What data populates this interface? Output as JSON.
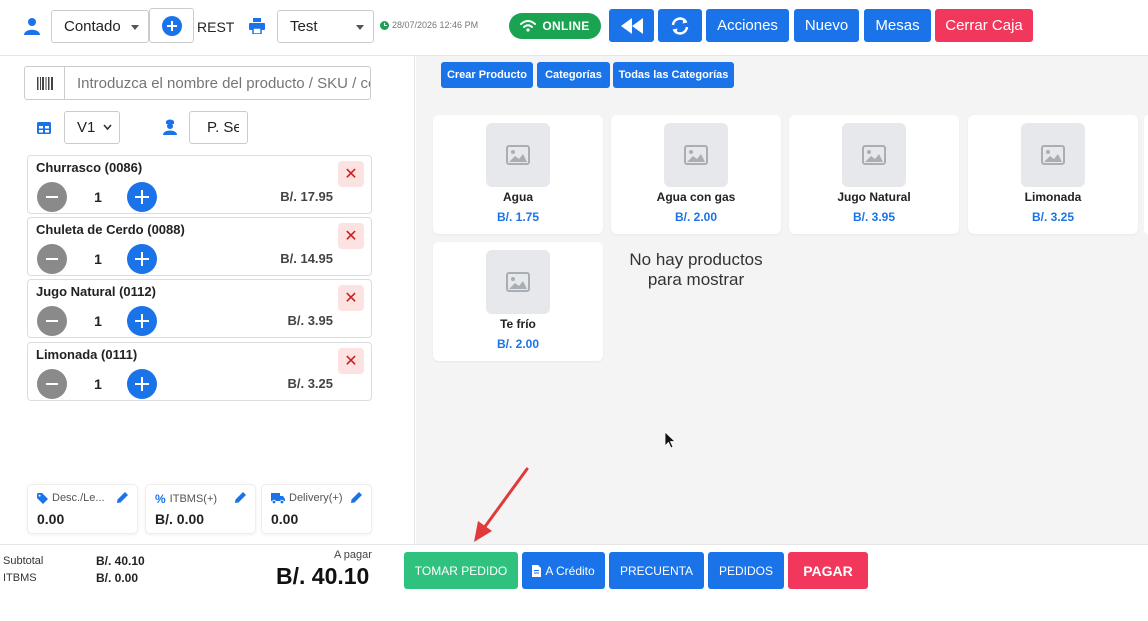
{
  "topbar": {
    "payment_type": "Contado",
    "mode_label": "REST",
    "printer_select": "Test",
    "datetime": "28/07/2026 12:46 PM",
    "online_label": "ONLINE",
    "acciones_label": "Acciones",
    "nuevo_label": "Nuevo",
    "mesas_label": "Mesas",
    "cerrar_caja_label": "Cerrar Caja"
  },
  "search": {
    "placeholder": "Introduzca el nombre del producto / SKU / có"
  },
  "filters": {
    "version_select": "V1",
    "price_select": "P. Se"
  },
  "cart_items": [
    {
      "name": "Churrasco (0086)",
      "qty": "1",
      "price": "B/. 17.95"
    },
    {
      "name": "Chuleta de Cerdo (0088)",
      "qty": "1",
      "price": "B/. 14.95"
    },
    {
      "name": "Jugo Natural (0112)",
      "qty": "1",
      "price": "B/. 3.95"
    },
    {
      "name": "Limonada (0111)",
      "qty": "1",
      "price": "B/. 3.25"
    }
  ],
  "adjustments": {
    "discount_label": "Desc./Le...",
    "discount_value": "0.00",
    "itbms_label": "ITBMS(+)",
    "itbms_value": "B/. 0.00",
    "delivery_label": "Delivery(+)",
    "delivery_value": "0.00"
  },
  "categories": {
    "create_product": "Crear Producto",
    "categories": "Categorías",
    "all_categories": "Todas las Categorías"
  },
  "products": [
    {
      "name": "Agua",
      "price": "B/. 1.75"
    },
    {
      "name": "Agua con gas",
      "price": "B/. 2.00"
    },
    {
      "name": "Jugo Natural",
      "price": "B/. 3.95"
    },
    {
      "name": "Limonada",
      "price": "B/. 3.25"
    },
    {
      "name": "Te frío",
      "price": "B/. 2.00"
    }
  ],
  "empty_message": "No hay productos para mostrar",
  "totals": {
    "subtotal_label": "Subtotal",
    "subtotal_value": "B/. 40.10",
    "itbms_label": "ITBMS",
    "itbms_value": "B/. 0.00",
    "to_pay_label": "A pagar",
    "to_pay_value": "B/. 40.10"
  },
  "actions": {
    "tomar_pedido": "TOMAR PEDIDO",
    "a_credito": "A Crédito",
    "precuenta": "PRECUENTA",
    "pedidos": "PEDIDOS",
    "pagar": "PAGAR"
  },
  "colors": {
    "primary": "#1a73e8",
    "danger": "#f1375c",
    "success": "#2ec27e",
    "online": "#1aa350"
  }
}
